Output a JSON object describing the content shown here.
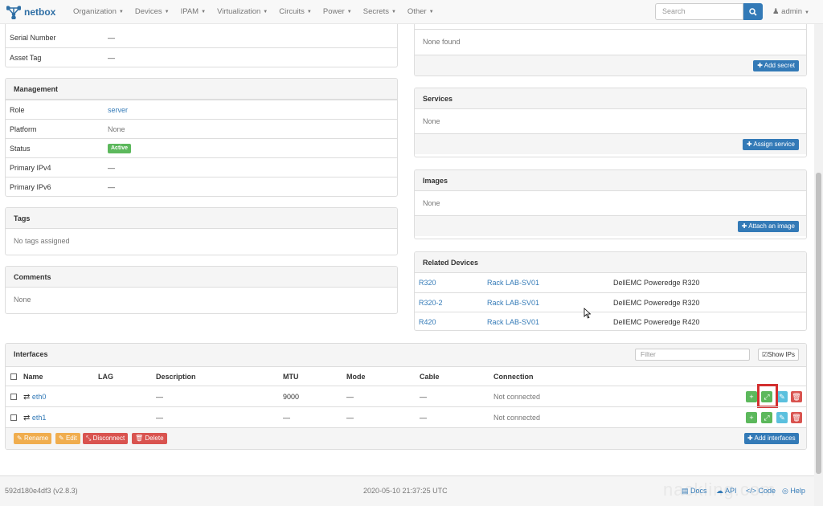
{
  "brand": "netbox",
  "nav": [
    "Organization",
    "Devices",
    "IPAM",
    "Virtualization",
    "Circuits",
    "Power",
    "Secrets",
    "Other"
  ],
  "search": {
    "placeholder": "Search"
  },
  "user": "admin",
  "left": {
    "serial_label": "Serial Number",
    "serial_value": "—",
    "asset_label": "Asset Tag",
    "asset_value": "—",
    "management": {
      "title": "Management",
      "role_label": "Role",
      "role_value": "server",
      "platform_label": "Platform",
      "platform_value": "None",
      "status_label": "Status",
      "status_value": "Active",
      "ipv4_label": "Primary IPv4",
      "ipv4_value": "—",
      "ipv6_label": "Primary IPv6",
      "ipv6_value": "—"
    },
    "tags": {
      "title": "Tags",
      "body": "No tags assigned"
    },
    "comments": {
      "title": "Comments",
      "body": "None"
    }
  },
  "right": {
    "secrets": {
      "body": "None found",
      "button": "Add secret"
    },
    "services": {
      "title": "Services",
      "body": "None",
      "button": "Assign service"
    },
    "images": {
      "title": "Images",
      "body": "None",
      "button": "Attach an image"
    },
    "related": {
      "title": "Related Devices",
      "rows": [
        {
          "name": "R320",
          "rack": "Rack LAB-SV01",
          "type": "DellEMC Poweredge R320"
        },
        {
          "name": "R320-2",
          "rack": "Rack LAB-SV01",
          "type": "DellEMC Poweredge R320"
        },
        {
          "name": "R420",
          "rack": "Rack LAB-SV01",
          "type": "DellEMC Poweredge R420"
        }
      ]
    }
  },
  "interfaces": {
    "title": "Interfaces",
    "filter_placeholder": "Filter",
    "show_ips": "Show IPs",
    "columns": {
      "name": "Name",
      "lag": "LAG",
      "description": "Description",
      "mtu": "MTU",
      "mode": "Mode",
      "cable": "Cable",
      "connection": "Connection"
    },
    "rows": [
      {
        "name": "eth0",
        "lag": "",
        "description": "—",
        "mtu": "9000",
        "mode": "—",
        "cable": "—",
        "connection": "Not connected"
      },
      {
        "name": "eth1",
        "lag": "",
        "description": "—",
        "mtu": "—",
        "mode": "—",
        "cable": "—",
        "connection": "Not connected"
      }
    ],
    "actions": {
      "rename": "Rename",
      "edit": "Edit",
      "disconnect": "Disconnect",
      "delete": "Delete",
      "add": "Add interfaces"
    }
  },
  "footer": {
    "version": "592d180e4df3 (v2.8.3)",
    "timestamp": "2020-05-10 21:37:25 UTC",
    "docs": "Docs",
    "api": "API",
    "code": "Code",
    "help": "Help",
    "watermark": "nackling.com"
  },
  "colors": {
    "primary": "#337ab7",
    "success": "#5cb85c",
    "info": "#5bc0de",
    "danger": "#d9534f",
    "warning": "#f0ad4e",
    "highlight": "#d32f2f"
  }
}
